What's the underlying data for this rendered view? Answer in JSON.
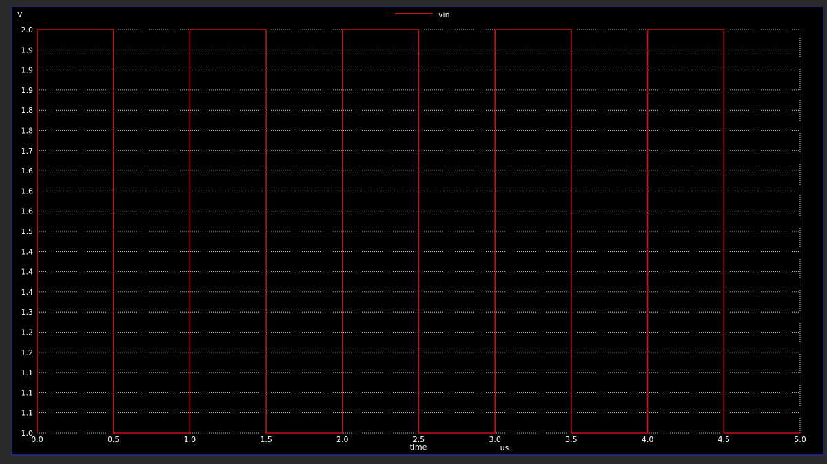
{
  "chart_data": {
    "type": "line",
    "title": "",
    "xlabel": "time",
    "xunit": "us",
    "ylabel": "V",
    "xlim": [
      0,
      5
    ],
    "ylim": [
      1.0,
      2.0
    ],
    "grid": true,
    "legend_position": "top-center",
    "x_ticks": [
      "0.0",
      "0.5",
      "1.0",
      "1.5",
      "2.0",
      "2.5",
      "3.0",
      "3.5",
      "4.0",
      "4.5",
      "5.0"
    ],
    "y_ticks": [
      "2.0",
      "1.9",
      "1.9",
      "1.9",
      "1.8",
      "1.8",
      "1.7",
      "1.6",
      "1.6",
      "1.6",
      "1.5",
      "1.4",
      "1.4",
      "1.4",
      "1.3",
      "1.2",
      "1.2",
      "1.1",
      "1.1",
      "1.1",
      "1.0"
    ],
    "colors": {
      "background": "#000000",
      "grid": "#ffffff",
      "series": "#cc1010"
    },
    "series": [
      {
        "name": "vin",
        "x": [
          0,
          0,
          0.5,
          0.5,
          1.0,
          1.0,
          1.5,
          1.5,
          2.0,
          2.0,
          2.5,
          2.5,
          3.0,
          3.0,
          3.5,
          3.5,
          4.0,
          4.0,
          4.5,
          4.5,
          5.0
        ],
        "y": [
          1.0,
          2.0,
          2.0,
          1.0,
          1.0,
          2.0,
          2.0,
          1.0,
          1.0,
          2.0,
          2.0,
          1.0,
          1.0,
          2.0,
          2.0,
          1.0,
          1.0,
          2.0,
          2.0,
          1.0,
          1.0
        ]
      }
    ]
  }
}
